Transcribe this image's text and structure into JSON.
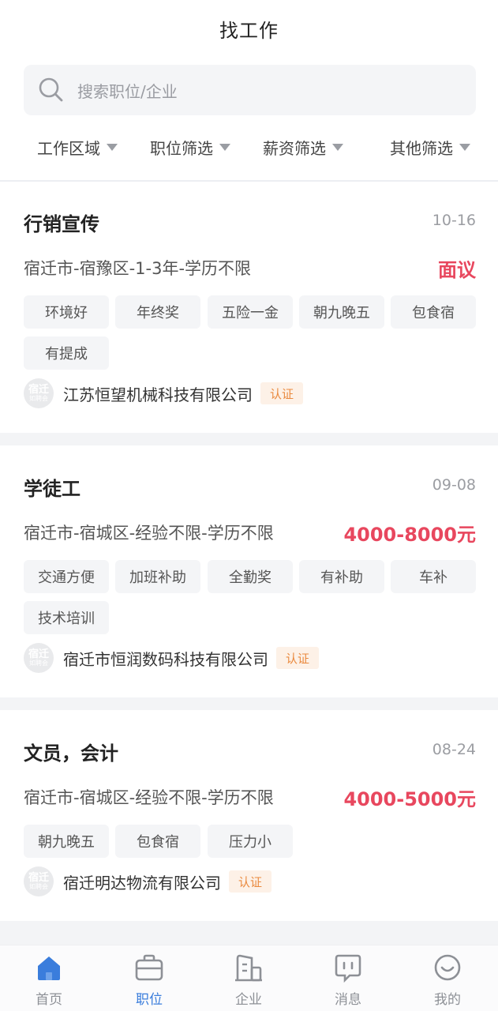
{
  "header": {
    "title": "找工作"
  },
  "search": {
    "placeholder": "搜索职位/企业"
  },
  "filters": [
    "工作区域",
    "职位筛选",
    "薪资筛选",
    "其他筛选"
  ],
  "jobs": [
    {
      "title": "行销宣传",
      "date": "10-16",
      "location": "宿迁市-宿豫区-1-3年-学历不限",
      "salary": "面议",
      "tags": [
        "环境好",
        "年终奖",
        "五险一金",
        "朝九晚五",
        "包食宿",
        "有提成"
      ],
      "company": "江苏恒望机械科技有限公司",
      "badge": "认证",
      "logo": {
        "line1": "宿迁",
        "line2": "如聘会"
      }
    },
    {
      "title": "学徒工",
      "date": "09-08",
      "location": "宿迁市-宿城区-经验不限-学历不限",
      "salary": "4000-8000元",
      "tags": [
        "交通方便",
        "加班补助",
        "全勤奖",
        "有补助",
        "车补",
        "技术培训"
      ],
      "company": "宿迁市恒润数码科技有限公司",
      "badge": "认证",
      "logo": {
        "line1": "宿迁",
        "line2": "如聘会"
      }
    },
    {
      "title": "文员，会计",
      "date": "08-24",
      "location": "宿迁市-宿城区-经验不限-学历不限",
      "salary": "4000-5000元",
      "tags": [
        "朝九晚五",
        "包食宿",
        "压力小"
      ],
      "company": "宿迁明达物流有限公司",
      "badge": "认证",
      "logo": {
        "line1": "宿迁",
        "line2": "如聘会"
      }
    }
  ],
  "tabbar": {
    "items": [
      {
        "label": "首页",
        "icon": "home-icon"
      },
      {
        "label": "职位",
        "icon": "briefcase-icon"
      },
      {
        "label": "企业",
        "icon": "building-icon"
      },
      {
        "label": "消息",
        "icon": "message-icon"
      },
      {
        "label": "我的",
        "icon": "profile-icon"
      }
    ],
    "active": "职位"
  },
  "colors": {
    "accent": "#3a7ddc",
    "salary": "#e8475e",
    "badge": "#ea8a3f"
  }
}
